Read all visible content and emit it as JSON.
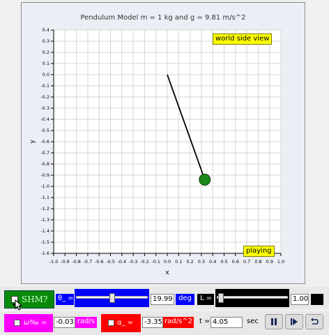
{
  "title": "Pendulum Model m = 1 kg and g = 9.81 m/s^2",
  "view_label": "world side view",
  "status_label": "playing",
  "axes": {
    "xlabel": "x",
    "ylabel": "y",
    "xlim": [
      -1.0,
      1.0
    ],
    "ylim": [
      -1.6,
      0.4
    ],
    "xticks": [
      "-1.0",
      "-0.9",
      "-0.8",
      "-0.7",
      "-0.6",
      "-0.5",
      "-0.4",
      "-0.3",
      "-0.2",
      "-0.1",
      "0.0",
      "0.1",
      "0.2",
      "0.3",
      "0.4",
      "0.5",
      "0.6",
      "0.7",
      "0.8",
      "0.9",
      "1.0"
    ],
    "yticks": [
      "0.4",
      "0.3",
      "0.2",
      "0.1",
      "0.0",
      "-0.1",
      "-0.2",
      "-0.3",
      "-0.4",
      "-0.5",
      "-0.6",
      "-0.7",
      "-0.8",
      "-0.9",
      "-1.0",
      "-1.1",
      "-1.2",
      "-1.3",
      "-1.4",
      "-1.5",
      "-1.6"
    ]
  },
  "pendulum": {
    "pivot": [
      0.0,
      0.0
    ],
    "bob": [
      0.33,
      -0.94
    ],
    "rod_color": "#000000",
    "bob_color": "#1a8a1a"
  },
  "controls": {
    "shm_checkbox_label": "SHM?",
    "shm_checked": true,
    "theta_label": "θ_ =",
    "theta_value": "19.99",
    "theta_unit": "deg",
    "theta_slider_fraction": 0.5,
    "length_label": "L =",
    "length_value": "1.00",
    "length_slider_fraction": 0.02,
    "omega_label": "ω‰ =",
    "omega_value": "-0.03",
    "omega_unit": "rad/s",
    "alpha_label": "α_ =",
    "alpha_value": "-3.35",
    "alpha_unit": "rad/s^2",
    "time_label": "t =",
    "time_value": "4.05",
    "time_unit": "sec",
    "pause_icon": "pause-icon",
    "step_icon": "step-forward-icon",
    "reset_icon": "reset-icon"
  },
  "colors": {
    "green": "#0a8a0a",
    "blue": "#0000ff",
    "magenta": "#ff00ff",
    "red": "#ff0000",
    "yellow": "#ffff00",
    "black": "#000000"
  }
}
